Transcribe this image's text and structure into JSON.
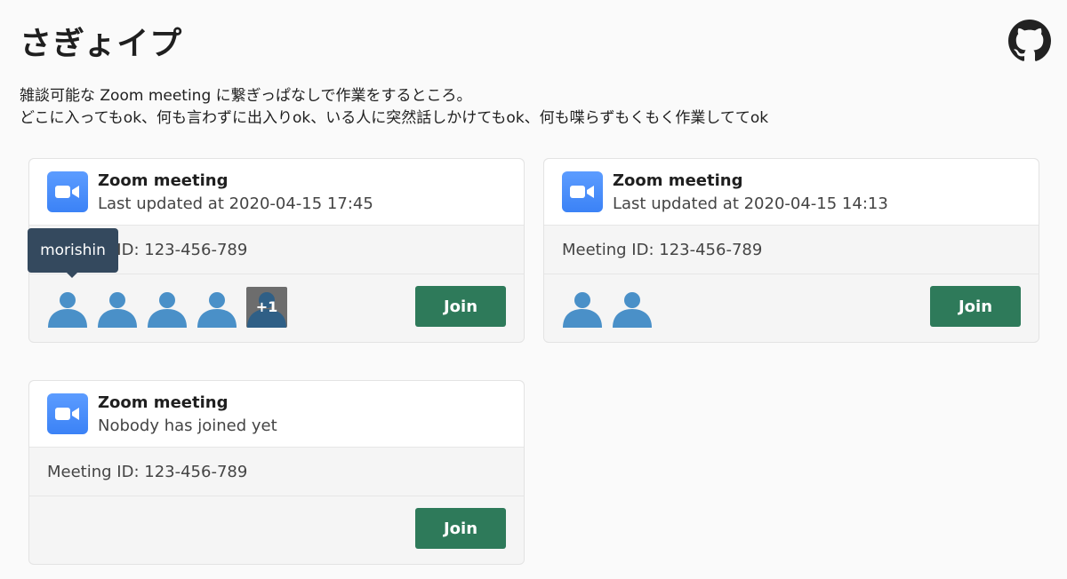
{
  "header": {
    "title": "さぎょイプ",
    "github_icon": "github-icon"
  },
  "description": {
    "line1": "雑談可能な Zoom meeting に繋ぎっぱなしで作業をするところ。",
    "line2": "どこに入ってもok、何も言わずに出入りok、いる人に突然話しかけてもok、何も喋らずもくもく作業しててok"
  },
  "colors": {
    "join_button": "#2e7a5a",
    "zoom_blue": "#3b82f6",
    "avatar_blue": "#4a90c8",
    "tooltip_bg": "#34495e"
  },
  "meetings": [
    {
      "title": "Zoom meeting",
      "status": "Last updated at 2020-04-15 17:45",
      "meeting_id": "Meeting ID: 123-456-789",
      "participants": [
        "person-icon",
        "person-icon",
        "person-icon",
        "person-icon"
      ],
      "more_count": "+1",
      "tooltip": "morishin",
      "join_label": "Join"
    },
    {
      "title": "Zoom meeting",
      "status": "Last updated at 2020-04-15 14:13",
      "meeting_id": "Meeting ID: 123-456-789",
      "participants": [
        "person-icon",
        "person-icon"
      ],
      "join_label": "Join"
    },
    {
      "title": "Zoom meeting",
      "status": "Nobody has joined yet",
      "meeting_id": "Meeting ID: 123-456-789",
      "participants": [],
      "join_label": "Join"
    }
  ]
}
